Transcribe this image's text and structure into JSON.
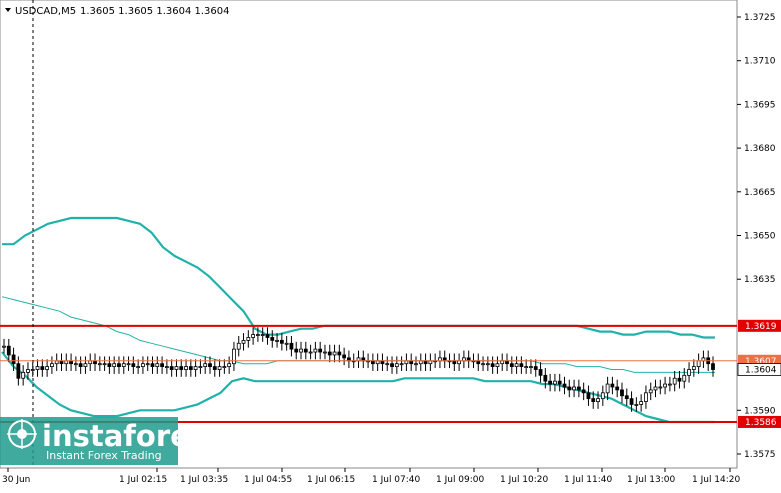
{
  "header": {
    "symbol_label": "USDCAD,M5",
    "ohlc_text": "1.3605 1.3605 1.3604 1.3604"
  },
  "watermark": {
    "brand": "instaforex",
    "tagline": "Instant Forex Trading"
  },
  "colors": {
    "background": "#ffffff",
    "bollinger": "#20b2aa",
    "level_line": "#e00000",
    "current_price_line": "#f07040",
    "candles": "#000000",
    "watermark_bg": "#1e9b8d"
  },
  "chart_data": {
    "type": "candlestick",
    "y_ticks": [
      "1.3725",
      "1.3710",
      "1.3695",
      "1.3680",
      "1.3665",
      "1.3650",
      "1.3635",
      "1.3590",
      "1.3575"
    ],
    "x_ticks": [
      "30 Jun",
      "1 Jul 02:15",
      "1 Jul 03:35",
      "1 Jul 04:55",
      "1 Jul 06:15",
      "1 Jul 07:40",
      "1 Jul 09:00",
      "1 Jul 10:20",
      "1 Jul 11:40",
      "1 Jul 13:00",
      "1 Jul 14:20"
    ],
    "ylim": [
      1.357,
      1.373
    ],
    "levels": [
      {
        "label": "1.3619",
        "value": 1.3619,
        "kind": "resistance"
      },
      {
        "label": "1.3586",
        "value": 1.3586,
        "kind": "support"
      }
    ],
    "price_markers": [
      {
        "label": "1.3607",
        "value": 1.3607,
        "kind": "ask"
      },
      {
        "label": "1.3604",
        "value": 1.3604,
        "kind": "bid"
      }
    ],
    "close_series": [
      1.3612,
      1.3609,
      1.3606,
      1.3601,
      1.3603,
      1.3604,
      1.3604,
      1.3605,
      1.3604,
      1.3605,
      1.3606,
      1.3607,
      1.3606,
      1.3607,
      1.3606,
      1.3606,
      1.3605,
      1.3606,
      1.3607,
      1.3606,
      1.3606,
      1.3606,
      1.3605,
      1.3606,
      1.3605,
      1.3606,
      1.3606,
      1.3605,
      1.3605,
      1.3606,
      1.3606,
      1.3605,
      1.3606,
      1.3605,
      1.3605,
      1.3604,
      1.3605,
      1.3604,
      1.3605,
      1.3604,
      1.3605,
      1.3605,
      1.3606,
      1.3605,
      1.3604,
      1.3605,
      1.3605,
      1.3606,
      1.3611,
      1.3613,
      1.3614,
      1.3615,
      1.3616,
      1.3616,
      1.3616,
      1.3615,
      1.3614,
      1.3614,
      1.3613,
      1.3613,
      1.3611,
      1.361,
      1.3611,
      1.361,
      1.361,
      1.3611,
      1.361,
      1.361,
      1.3609,
      1.361,
      1.3609,
      1.3608,
      1.3607,
      1.3607,
      1.3608,
      1.3607,
      1.3607,
      1.3606,
      1.3607,
      1.3606,
      1.3606,
      1.3605,
      1.3606,
      1.3606,
      1.3607,
      1.3606,
      1.3606,
      1.3607,
      1.3606,
      1.3607,
      1.3607,
      1.3608,
      1.3607,
      1.3607,
      1.3606,
      1.3607,
      1.3608,
      1.3607,
      1.3607,
      1.3606,
      1.3606,
      1.3606,
      1.3605,
      1.3606,
      1.3607,
      1.3606,
      1.3605,
      1.3606,
      1.3605,
      1.3605,
      1.3605,
      1.3604,
      1.3602,
      1.36,
      1.3599,
      1.36,
      1.3599,
      1.3598,
      1.3597,
      1.3598,
      1.3597,
      1.3596,
      1.3594,
      1.3593,
      1.3594,
      1.3596,
      1.3599,
      1.3598,
      1.3597,
      1.3595,
      1.3594,
      1.3592,
      1.3592,
      1.3593,
      1.3596,
      1.3597,
      1.3598,
      1.3598,
      1.3599,
      1.3599,
      1.3601,
      1.36,
      1.3602,
      1.3604,
      1.3605,
      1.3607,
      1.3608,
      1.3606,
      1.3604
    ],
    "bollinger_upper": [
      1.3647,
      1.3647,
      1.365,
      1.3652,
      1.3654,
      1.3655,
      1.3656,
      1.3656,
      1.3656,
      1.3656,
      1.3656,
      1.3655,
      1.3654,
      1.3651,
      1.3646,
      1.3643,
      1.3641,
      1.3639,
      1.3636,
      1.3632,
      1.3628,
      1.3624,
      1.3618,
      1.3616,
      1.3616,
      1.3617,
      1.3618,
      1.3618,
      1.3619,
      1.3619,
      1.3619,
      1.3619,
      1.3619,
      1.3619,
      1.3619,
      1.3619,
      1.3619,
      1.3619,
      1.3619,
      1.3619,
      1.3619,
      1.3619,
      1.3619,
      1.3619,
      1.3619,
      1.3619,
      1.3619,
      1.3619,
      1.3619,
      1.3619,
      1.3619,
      1.3618,
      1.3617,
      1.3617,
      1.3616,
      1.3616,
      1.3617,
      1.3617,
      1.3617,
      1.3616,
      1.3616,
      1.3615,
      1.3615
    ],
    "bollinger_middle": [
      1.3629,
      1.3628,
      1.3627,
      1.3626,
      1.3625,
      1.3624,
      1.3622,
      1.3621,
      1.362,
      1.3619,
      1.3617,
      1.3616,
      1.3614,
      1.3613,
      1.3612,
      1.3611,
      1.361,
      1.3609,
      1.3608,
      1.3607,
      1.3607,
      1.3606,
      1.3606,
      1.3606,
      1.3607,
      1.3607,
      1.3607,
      1.3607,
      1.3607,
      1.3607,
      1.3607,
      1.3607,
      1.3607,
      1.3607,
      1.3607,
      1.3607,
      1.3607,
      1.3607,
      1.3607,
      1.3607,
      1.3607,
      1.3607,
      1.3607,
      1.3607,
      1.3607,
      1.3607,
      1.3607,
      1.3606,
      1.3606,
      1.3606,
      1.3605,
      1.3605,
      1.3605,
      1.3604,
      1.3604,
      1.3603,
      1.3603,
      1.3603,
      1.3603,
      1.3603,
      1.3603,
      1.3603,
      1.3603
    ],
    "bollinger_lower": [
      1.361,
      1.3605,
      1.3602,
      1.3598,
      1.3595,
      1.3592,
      1.359,
      1.3589,
      1.3588,
      1.3588,
      1.3588,
      1.3589,
      1.359,
      1.359,
      1.359,
      1.359,
      1.3591,
      1.3592,
      1.3594,
      1.3596,
      1.36,
      1.3601,
      1.36,
      1.36,
      1.36,
      1.36,
      1.36,
      1.36,
      1.36,
      1.36,
      1.36,
      1.36,
      1.36,
      1.36,
      1.36,
      1.3601,
      1.3601,
      1.3601,
      1.3601,
      1.3601,
      1.3601,
      1.3601,
      1.36,
      1.36,
      1.36,
      1.36,
      1.36,
      1.3599,
      1.3599,
      1.3598,
      1.3597,
      1.3596,
      1.3595,
      1.3594,
      1.3592,
      1.359,
      1.3588,
      1.3587,
      1.3586,
      1.3586,
      1.3586,
      1.3586,
      1.3586
    ],
    "grid": true
  }
}
